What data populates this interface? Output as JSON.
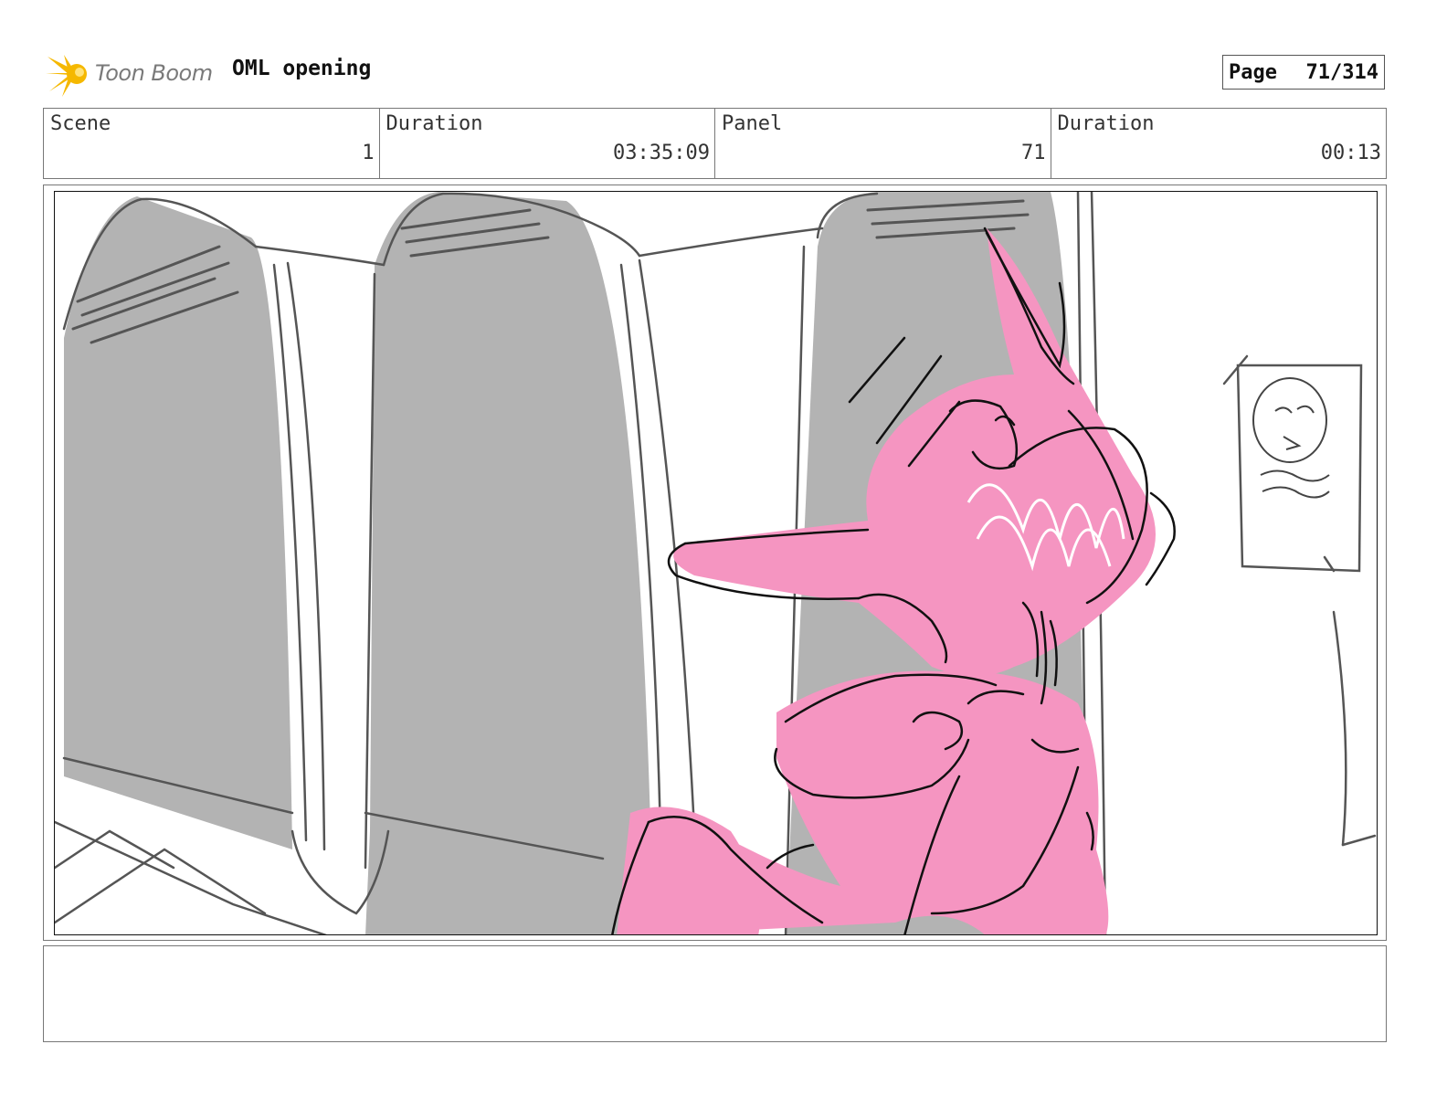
{
  "header": {
    "logo_text": "Toon Boom",
    "project_title": "OML opening",
    "page_label": "Page",
    "page_number": "71/314"
  },
  "info": {
    "scene_label": "Scene",
    "scene_value": "1",
    "scene_duration_label": "Duration",
    "scene_duration_value": "03:35:09",
    "panel_label": "Panel",
    "panel_value": "71",
    "panel_duration_label": "Duration",
    "panel_duration_value": "00:13"
  },
  "colors": {
    "character_pink": "#f595c1",
    "wall_gray": "#b3b3b3",
    "logo_yellow": "#f5b800"
  },
  "icons": {
    "logo": "toon-boom-starburst-icon"
  },
  "notes": {
    "text": ""
  }
}
